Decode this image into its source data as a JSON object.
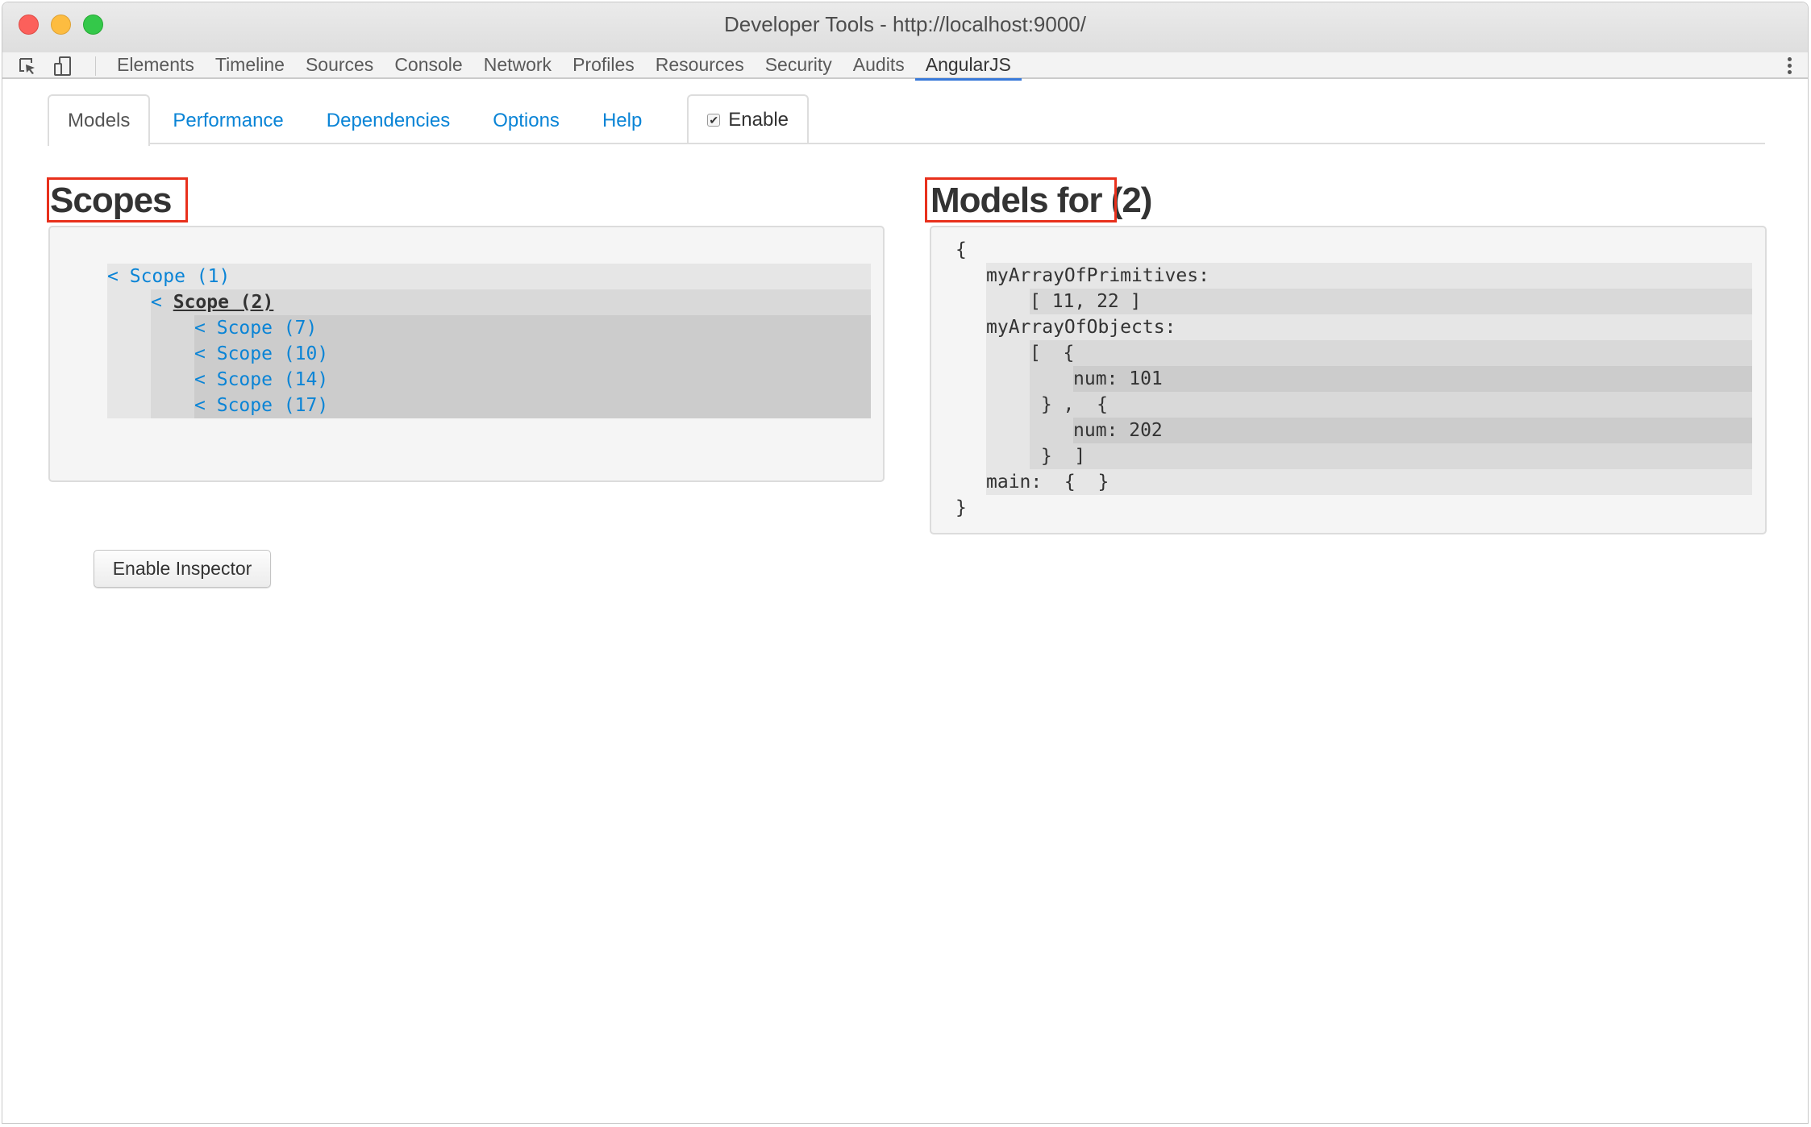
{
  "window": {
    "title": "Developer Tools - http://localhost:9000/"
  },
  "toolbar": {
    "icons": [
      "inspect-element-icon",
      "device-mode-icon"
    ],
    "tabs": [
      {
        "label": "Elements"
      },
      {
        "label": "Timeline"
      },
      {
        "label": "Sources"
      },
      {
        "label": "Console"
      },
      {
        "label": "Network"
      },
      {
        "label": "Profiles"
      },
      {
        "label": "Resources"
      },
      {
        "label": "Security"
      },
      {
        "label": "Audits"
      },
      {
        "label": "AngularJS",
        "active": true
      }
    ],
    "menu_icon": "kebab-menu-icon"
  },
  "subtabs": {
    "items": [
      {
        "label": "Models",
        "active": true
      },
      {
        "label": "Performance"
      },
      {
        "label": "Dependencies"
      },
      {
        "label": "Options"
      },
      {
        "label": "Help"
      }
    ],
    "enable": {
      "label": "Enable",
      "checked": true,
      "check_glyph": "✔"
    }
  },
  "scopes": {
    "heading": "Scopes",
    "tree": {
      "arrow": "<",
      "label": "Scope (1)",
      "children": [
        {
          "label": "Scope (2)",
          "selected": true,
          "children": [
            {
              "label": "Scope (7)"
            },
            {
              "label": "Scope (10)"
            },
            {
              "label": "Scope (14)"
            },
            {
              "label": "Scope (17)"
            }
          ]
        }
      ]
    }
  },
  "models": {
    "heading_prefix": "Models for",
    "heading_suffix": "(2)",
    "lines": {
      "open": "{",
      "k1": "myArrayOfPrimitives:",
      "v1": "[ 11, 22 ]",
      "k2": "myArrayOfObjects:",
      "arr_open": "[  {",
      "num1": "num: 101",
      "sep": " } ,  {",
      "num2": "num: 202",
      "arr_close": " }  ]",
      "k3": "main:  {  }",
      "close": "}"
    }
  },
  "inspector_button": {
    "label": "Enable Inspector"
  },
  "colors": {
    "link": "#0a84d6",
    "highlight_box": "#e8301c",
    "active_tab_underline": "#3879d9"
  }
}
